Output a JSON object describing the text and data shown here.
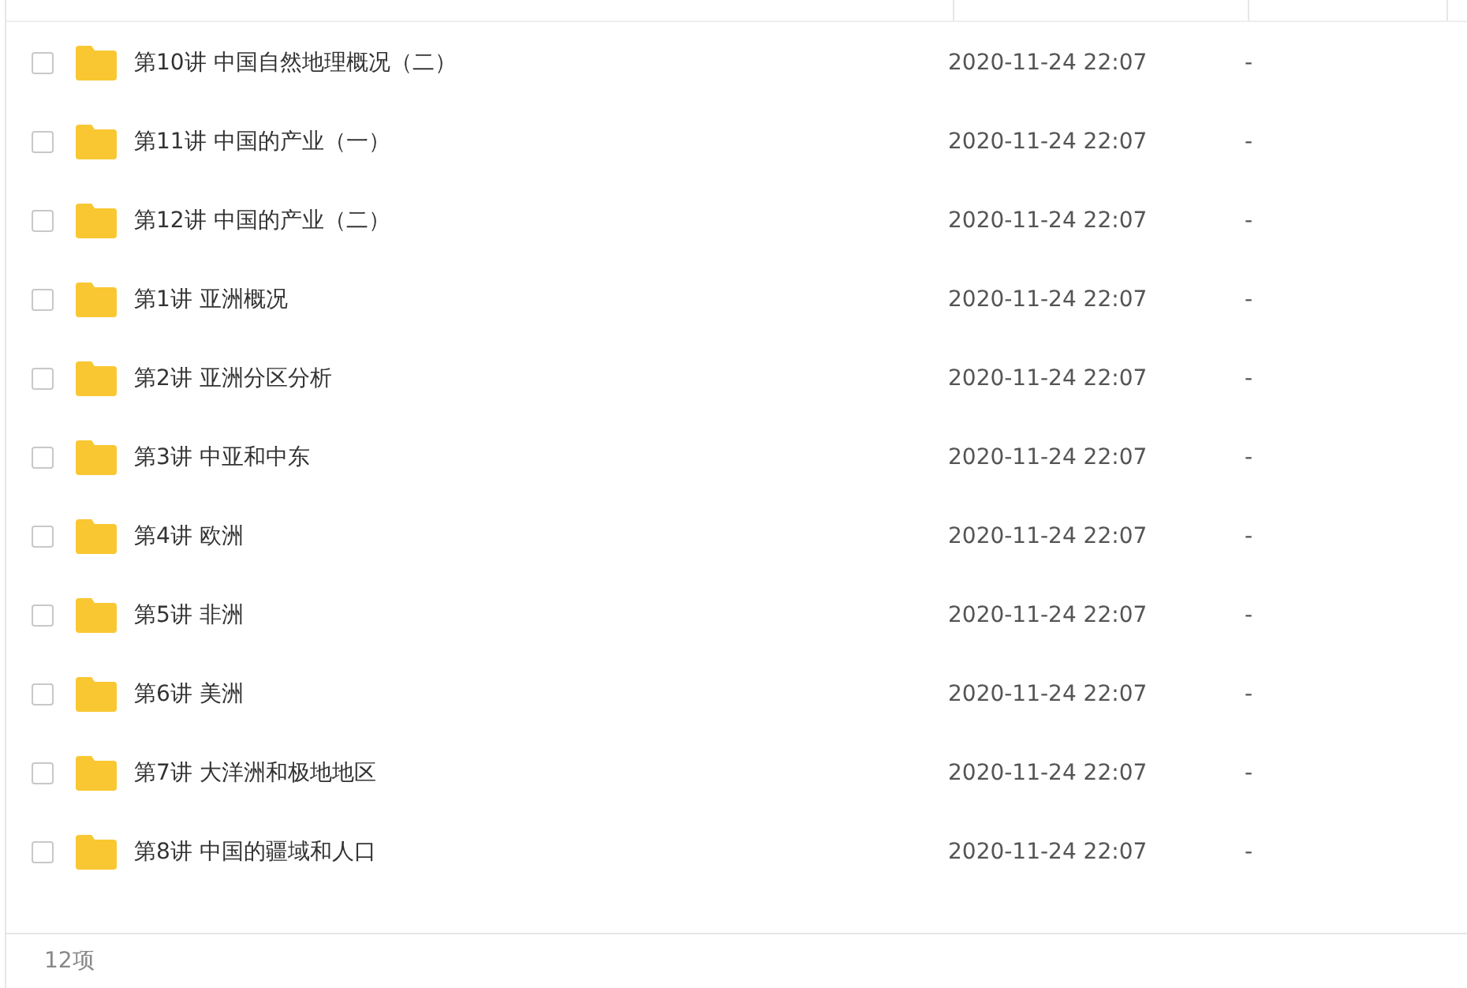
{
  "files": [
    {
      "name": "第10讲 中国自然地理概况（二）",
      "modified": "2020-11-24 22:07",
      "size": "-",
      "checked": false
    },
    {
      "name": "第11讲 中国的产业（一）",
      "modified": "2020-11-24 22:07",
      "size": "-",
      "checked": false
    },
    {
      "name": "第12讲 中国的产业（二）",
      "modified": "2020-11-24 22:07",
      "size": "-",
      "checked": false
    },
    {
      "name": "第1讲 亚洲概况",
      "modified": "2020-11-24 22:07",
      "size": "-",
      "checked": false
    },
    {
      "name": "第2讲 亚洲分区分析",
      "modified": "2020-11-24 22:07",
      "size": "-",
      "checked": false
    },
    {
      "name": "第3讲 中亚和中东",
      "modified": "2020-11-24 22:07",
      "size": "-",
      "checked": false
    },
    {
      "name": "第4讲 欧洲",
      "modified": "2020-11-24 22:07",
      "size": "-",
      "checked": false
    },
    {
      "name": "第5讲 非洲",
      "modified": "2020-11-24 22:07",
      "size": "-",
      "checked": false
    },
    {
      "name": "第6讲 美洲",
      "modified": "2020-11-24 22:07",
      "size": "-",
      "checked": false
    },
    {
      "name": "第7讲 大洋洲和极地地区",
      "modified": "2020-11-24 22:07",
      "size": "-",
      "checked": false
    },
    {
      "name": "第8讲 中国的疆域和人口",
      "modified": "2020-11-24 22:07",
      "size": "-",
      "checked": false
    }
  ],
  "status_bar": {
    "count": "12项"
  }
}
